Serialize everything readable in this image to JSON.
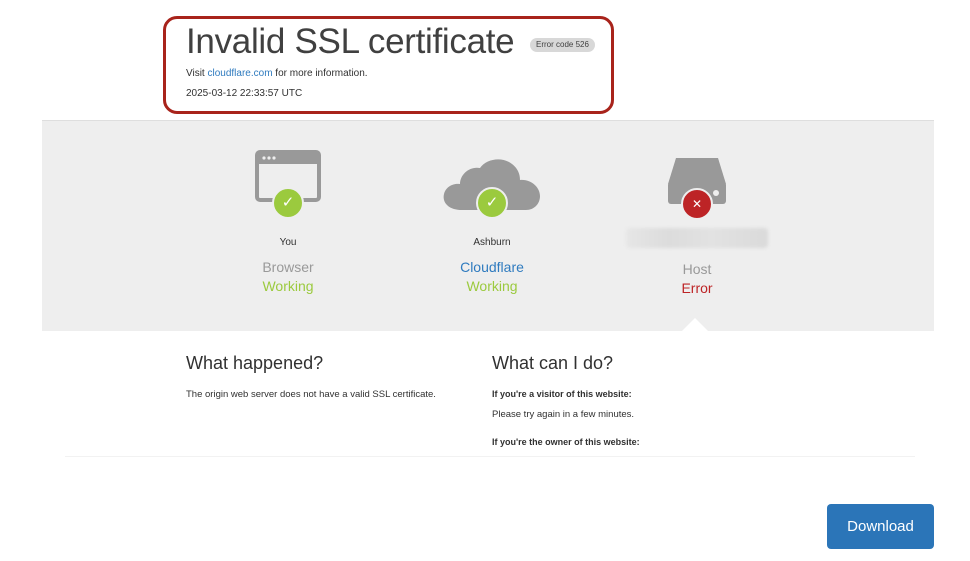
{
  "header": {
    "title": "Invalid SSL certificate",
    "error_code": "Error code 526",
    "visit_prefix": "Visit ",
    "visit_link": "cloudflare.com",
    "visit_suffix": " for more information.",
    "timestamp": "2025-03-12 22:33:57 UTC"
  },
  "status": {
    "nodes": [
      {
        "location": "You",
        "name": "Browser",
        "status": "Working",
        "icon": "browser-icon",
        "state": "ok"
      },
      {
        "location": "Ashburn",
        "name": "Cloudflare",
        "status": "Working",
        "icon": "cloud-icon",
        "state": "ok"
      },
      {
        "location": "",
        "name": "Host",
        "status": "Error",
        "icon": "server-icon",
        "state": "error"
      }
    ]
  },
  "what_happened": {
    "heading": "What happened?",
    "text": "The origin web server does not have a valid SSL certificate."
  },
  "what_can_i_do": {
    "heading": "What can I do?",
    "visitor_heading": "If you're a visitor of this website:",
    "visitor_text": "Please try again in a few minutes.",
    "owner_heading": "If you're the owner of this website:"
  },
  "download_label": "Download",
  "colors": {
    "highlight_border": "#a8231b",
    "working": "#9bca3e",
    "error": "#bd2426",
    "link": "#2f7bbf",
    "button": "#2b75b8"
  }
}
